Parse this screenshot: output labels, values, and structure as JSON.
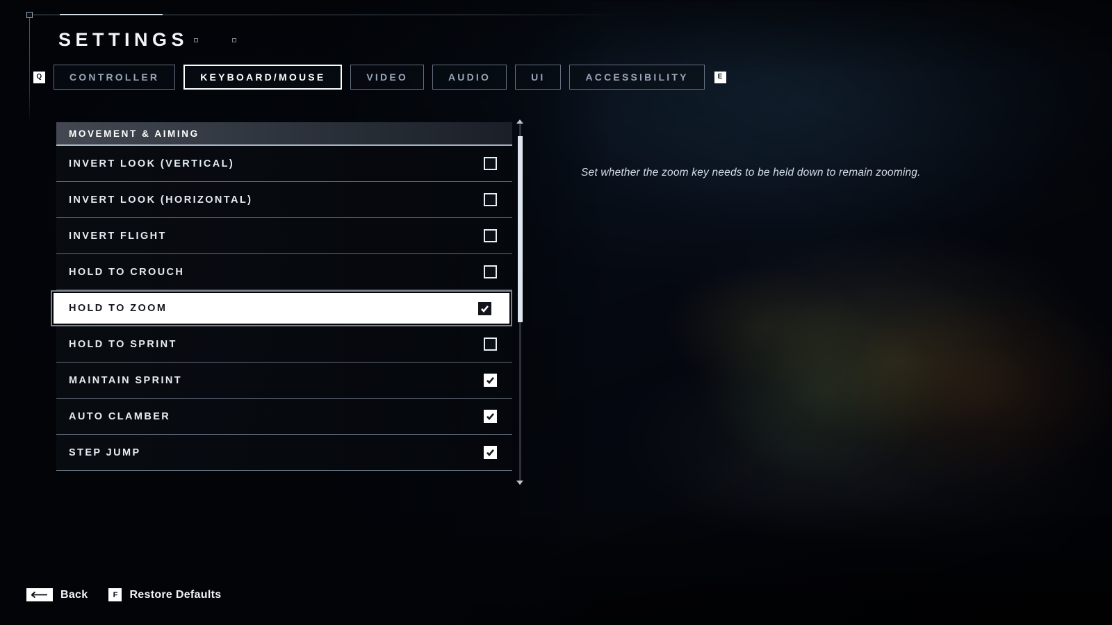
{
  "header": {
    "title": "SETTINGS",
    "decor_dots": 2
  },
  "tabbar": {
    "prev_key": "Q",
    "next_key": "E",
    "tabs": [
      {
        "label": "CONTROLLER",
        "active": false
      },
      {
        "label": "KEYBOARD/MOUSE",
        "active": true
      },
      {
        "label": "VIDEO",
        "active": false
      },
      {
        "label": "AUDIO",
        "active": false
      },
      {
        "label": "UI",
        "active": false
      },
      {
        "label": "ACCESSIBILITY",
        "active": false
      }
    ]
  },
  "settings": {
    "section_title": "MOVEMENT & AIMING",
    "rows": [
      {
        "label": "INVERT LOOK (VERTICAL)",
        "checked": false,
        "selected": false
      },
      {
        "label": "INVERT LOOK (HORIZONTAL)",
        "checked": false,
        "selected": false
      },
      {
        "label": "INVERT FLIGHT",
        "checked": false,
        "selected": false
      },
      {
        "label": "HOLD TO CROUCH",
        "checked": false,
        "selected": false
      },
      {
        "label": "HOLD TO ZOOM",
        "checked": true,
        "selected": true
      },
      {
        "label": "HOLD TO SPRINT",
        "checked": false,
        "selected": false
      },
      {
        "label": "MAINTAIN SPRINT",
        "checked": true,
        "selected": false
      },
      {
        "label": "AUTO CLAMBER",
        "checked": true,
        "selected": false
      },
      {
        "label": "STEP JUMP",
        "checked": true,
        "selected": false
      }
    ]
  },
  "description": {
    "text": "Set whether the zoom key needs to be held down to remain zooming."
  },
  "footer": {
    "actions": [
      {
        "key": "back-arrow",
        "key_label": "←",
        "label": "Back"
      },
      {
        "key": "F",
        "key_label": "F",
        "label": "Restore Defaults"
      }
    ]
  },
  "colors": {
    "accent_white": "#ffffff",
    "text_primary": "#e7edf4",
    "text_muted": "#9aa7b8",
    "panel_bg": "#0a0d13",
    "selected_bg": "#ffffff",
    "selected_text": "#13171d"
  }
}
